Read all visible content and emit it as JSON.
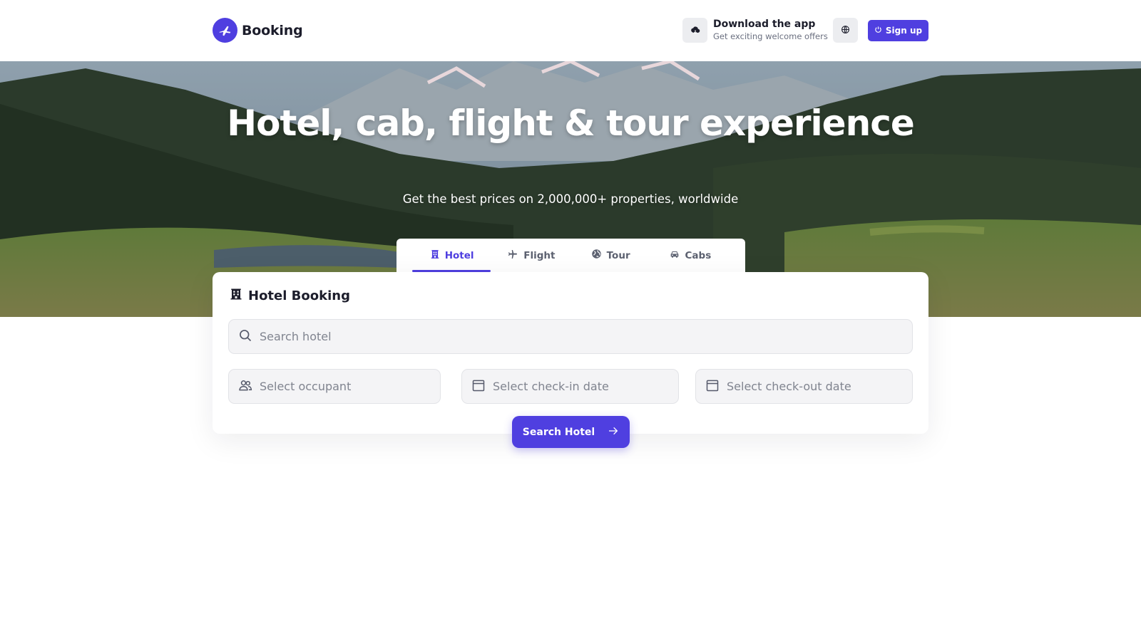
{
  "brand": {
    "name": "Booking"
  },
  "header": {
    "app_promo": {
      "title": "Download the app",
      "subtitle": "Get exciting welcome offers"
    },
    "signup_label": "Sign up"
  },
  "hero": {
    "title": "Hotel, cab, flight & tour experience",
    "subtitle": "Get the best prices on 2,000,000+ properties, worldwide"
  },
  "tabs": [
    {
      "label": "Hotel",
      "icon": "building-icon",
      "active": true
    },
    {
      "label": "Flight",
      "icon": "plane-icon",
      "active": false
    },
    {
      "label": "Tour",
      "icon": "globe-icon",
      "active": false
    },
    {
      "label": "Cabs",
      "icon": "car-icon",
      "active": false
    }
  ],
  "booking": {
    "title": "Hotel Booking",
    "search_placeholder": "Search hotel",
    "occupant_placeholder": "Select occupant",
    "checkin_placeholder": "Select check-in date",
    "checkout_placeholder": "Select check-out date",
    "submit_label": "Search Hotel"
  },
  "colors": {
    "accent": "#4f3fe0",
    "field_bg": "#f4f4f6"
  }
}
